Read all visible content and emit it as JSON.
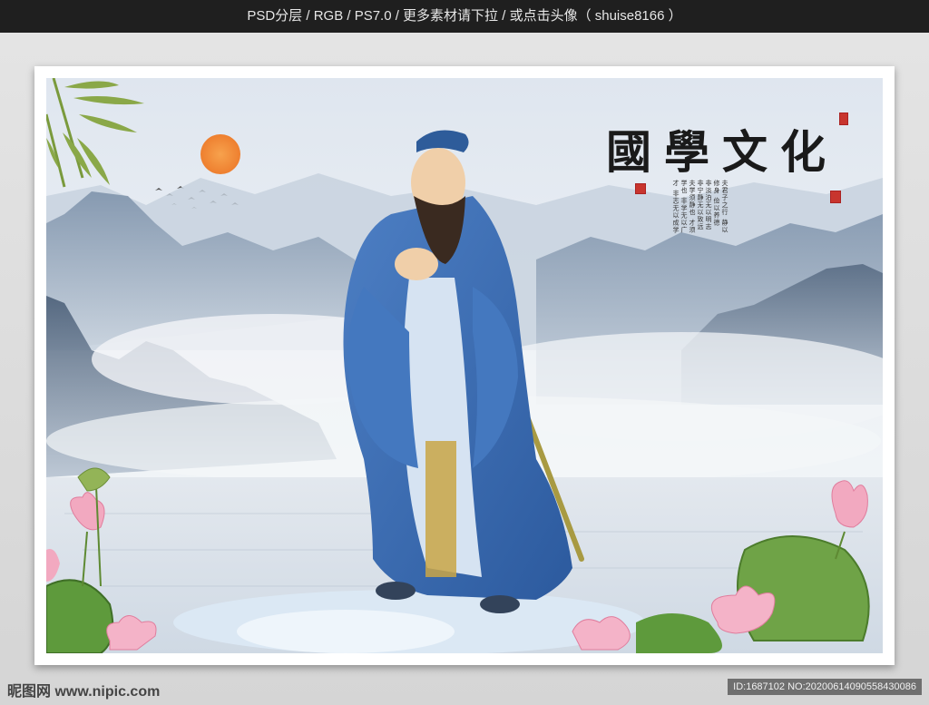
{
  "topbar": {
    "text": "PSD分层 / RGB / PS7.0 / 更多素材请下拉 / 或点击头像（ shuise8166 ）"
  },
  "poster": {
    "title": "國學文化",
    "poem_lines": [
      "夫君子之行",
      "静以修身",
      "俭以养德",
      "非淡泊无以明志",
      "非宁静无以致远",
      "夫学须静也",
      "才须学也",
      "非学无以广才",
      "非志无以成学"
    ]
  },
  "watermark": {
    "logo": "昵图网 www.nipic.com",
    "id": "ID:1687102 NO:20200614090558430086"
  },
  "colors": {
    "robe": "#3e6db3",
    "sun": "#f08a3a",
    "lotus": "#f2a9c0",
    "leaf": "#5e9a3c"
  }
}
